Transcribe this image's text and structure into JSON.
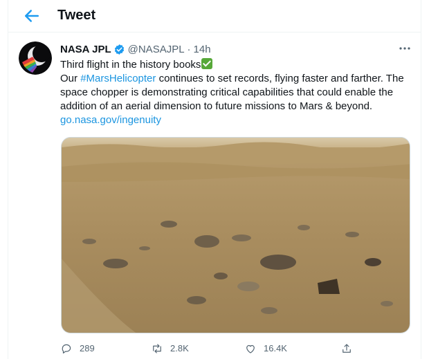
{
  "header": {
    "title": "Tweet"
  },
  "tweet": {
    "author_name": "NASA JPL",
    "handle": "@NASAJPL",
    "separator": "·",
    "time": "14h",
    "line1_text": "Third flight in the history books",
    "line2_prefix": "Our ",
    "hashtag": "#MarsHelicopter",
    "line2_rest": " continues to set records, flying faster and farther. The space chopper is demonstrating critical capabilities that could enable the addition of an aerial dimension to future missions to Mars & beyond.",
    "url": "go.nasa.gov/ingenuity"
  },
  "actions": {
    "replies": "289",
    "retweets": "2.8K",
    "likes": "16.4K"
  },
  "colors": {
    "accent": "#1d9bf0",
    "link": "#1b95e0",
    "check": "#57a839"
  }
}
